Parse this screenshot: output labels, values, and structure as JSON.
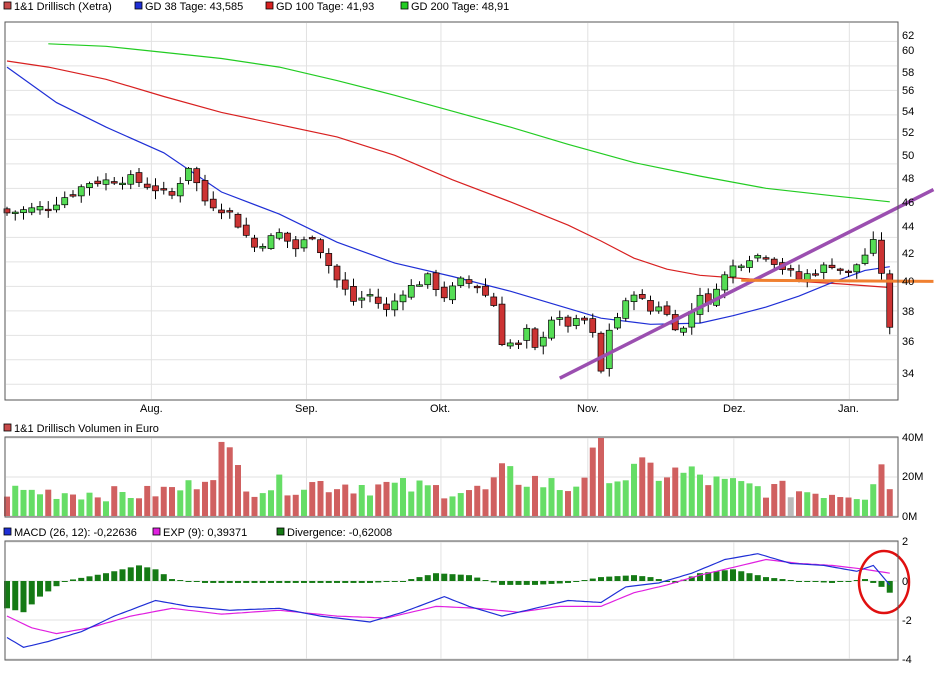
{
  "price_panel": {
    "legend": [
      {
        "label": "1&1 Drillisch (Xetra)",
        "color": "#c84a4a"
      },
      {
        "label": "GD 38 Tage: 43,585",
        "color": "#1f2fd6"
      },
      {
        "label": "GD 100 Tage: 41,93",
        "color": "#d82020"
      },
      {
        "label": "GD 200 Tage: 48,91",
        "color": "#22cc22"
      }
    ],
    "y_ticks": [
      "62",
      "60",
      "58",
      "56",
      "54",
      "52",
      "50",
      "48",
      "46",
      "44",
      "42",
      "40",
      "38",
      "36",
      "34"
    ],
    "x_ticks": [
      "Aug.",
      "Sep.",
      "Okt.",
      "Nov.",
      "Dez.",
      "Jan."
    ],
    "colors": {
      "up": "#55dd55",
      "down": "#cc3333",
      "trend": "#9b4fb0",
      "support": "#f08030"
    }
  },
  "volume_panel": {
    "title": "1&1 Drillisch Volumen in Euro",
    "y_ticks": [
      "40M",
      "20M",
      "0M"
    ]
  },
  "macd_panel": {
    "legend": [
      {
        "label": "MACD (26, 12): -0,22636",
        "color": "#1f2fd6"
      },
      {
        "label": "EXP (9): 0,39371",
        "color": "#e020e0"
      },
      {
        "label": "Divergence: -0,62008",
        "color": "#157a15"
      }
    ],
    "y_ticks": [
      "2",
      "0",
      "-2",
      "-4"
    ]
  },
  "chart_data": [
    {
      "type": "candlestick",
      "title": "1&1 Drillisch (Xetra)",
      "ylim": [
        32.8,
        63.5
      ],
      "x_ticks": [
        "Aug.",
        "Sep.",
        "Okt.",
        "Nov.",
        "Dez.",
        "Jan."
      ],
      "close_path": [
        [
          0,
          48.0
        ],
        [
          5,
          48.5
        ],
        [
          10,
          50.5
        ],
        [
          15,
          50.8
        ],
        [
          20,
          49.4
        ],
        [
          22,
          51.8
        ],
        [
          24,
          49.0
        ],
        [
          27,
          48.0
        ],
        [
          30,
          45.2
        ],
        [
          33,
          46.3
        ],
        [
          35,
          45.1
        ],
        [
          37,
          46.2
        ],
        [
          40,
          42.5
        ],
        [
          42,
          40.8
        ],
        [
          44,
          41.3
        ],
        [
          46,
          40.0
        ],
        [
          48,
          41.6
        ],
        [
          51,
          42.7
        ],
        [
          53,
          41.2
        ],
        [
          55,
          42.4
        ],
        [
          57,
          42.1
        ],
        [
          59,
          40.5
        ],
        [
          60,
          37.5
        ],
        [
          62,
          37.2
        ],
        [
          63,
          38.3
        ],
        [
          64,
          36.8
        ],
        [
          66,
          39.4
        ],
        [
          68,
          38.9
        ],
        [
          70,
          39.2
        ],
        [
          71,
          38.0
        ],
        [
          72,
          35.0
        ],
        [
          73,
          38.5
        ],
        [
          74,
          39.5
        ],
        [
          76,
          41.6
        ],
        [
          78,
          40.0
        ],
        [
          79,
          40.5
        ],
        [
          81,
          38.8
        ],
        [
          82,
          38.5
        ],
        [
          84,
          41.5
        ],
        [
          85,
          40.3
        ],
        [
          86,
          42.1
        ],
        [
          88,
          43.6
        ],
        [
          90,
          44.4
        ],
        [
          92,
          44.6
        ],
        [
          94,
          43.5
        ],
        [
          96,
          42.6
        ],
        [
          98,
          43.3
        ],
        [
          100,
          43.8
        ],
        [
          102,
          43.0
        ],
        [
          104,
          44.6
        ],
        [
          105,
          45.5
        ],
        [
          106,
          43.2
        ],
        [
          107,
          38.4
        ]
      ],
      "series": [
        {
          "name": "GD 38 Tage: 43,585",
          "color": "#1f2fd6",
          "path": [
            [
              0,
              59.9
            ],
            [
              6,
              57.0
            ],
            [
              12,
              55.0
            ],
            [
              19,
              52.9
            ],
            [
              26,
              49.7
            ],
            [
              33,
              47.9
            ],
            [
              40,
              45.6
            ],
            [
              47,
              43.9
            ],
            [
              54,
              42.8
            ],
            [
              61,
              41.6
            ],
            [
              67,
              40.4
            ],
            [
              72,
              39.4
            ],
            [
              78,
              38.9
            ],
            [
              84,
              39.0
            ],
            [
              88,
              39.6
            ],
            [
              92,
              40.3
            ],
            [
              96,
              41.2
            ],
            [
              100,
              42.3
            ],
            [
              104,
              43.3
            ],
            [
              107,
              43.6
            ]
          ]
        },
        {
          "name": "GD 100 Tage: 41,93",
          "color": "#d82020",
          "path": [
            [
              0,
              60.4
            ],
            [
              5,
              59.9
            ],
            [
              12,
              58.9
            ],
            [
              19,
              57.5
            ],
            [
              26,
              56.2
            ],
            [
              33,
              55.2
            ],
            [
              40,
              54.2
            ],
            [
              47,
              52.7
            ],
            [
              54,
              50.7
            ],
            [
              61,
              48.9
            ],
            [
              68,
              47.0
            ],
            [
              72,
              45.7
            ],
            [
              76,
              44.3
            ],
            [
              80,
              43.4
            ],
            [
              84,
              42.9
            ],
            [
              90,
              42.6
            ],
            [
              96,
              42.4
            ],
            [
              101,
              42.2
            ],
            [
              107,
              41.9
            ]
          ]
        },
        {
          "name": "GD 200 Tage: 48,91",
          "color": "#22cc22",
          "path": [
            [
              5,
              61.8
            ],
            [
              12,
              61.6
            ],
            [
              19,
              61.1
            ],
            [
              26,
              60.6
            ],
            [
              33,
              59.9
            ],
            [
              40,
              58.8
            ],
            [
              47,
              57.6
            ],
            [
              54,
              56.3
            ],
            [
              61,
              55.0
            ],
            [
              68,
              53.6
            ],
            [
              76,
              52.1
            ],
            [
              84,
              51.0
            ],
            [
              92,
              50.0
            ],
            [
              100,
              49.4
            ],
            [
              107,
              48.9
            ]
          ]
        }
      ],
      "trendlines": [
        {
          "name": "Aufwärtstrend",
          "from": [
            67,
            34.5
          ],
          "to": [
            112.3,
            49.9
          ]
        },
        {
          "name": "Unterstützung",
          "from": [
            89,
            42.5
          ],
          "to": [
            112.3,
            42.4
          ]
        }
      ]
    },
    {
      "type": "bar",
      "title": "1&1 Drillisch Volumen in Euro",
      "ylim": [
        0,
        40
      ],
      "unit": "M EUR",
      "volume_profile": [
        [
          0,
          14
        ],
        [
          8,
          13
        ],
        [
          16,
          12
        ],
        [
          22,
          16
        ],
        [
          26,
          35
        ],
        [
          30,
          16
        ],
        [
          36,
          18
        ],
        [
          40,
          18
        ],
        [
          48,
          16
        ],
        [
          52,
          15
        ],
        [
          58,
          14
        ],
        [
          60,
          22
        ],
        [
          63,
          21
        ],
        [
          68,
          15
        ],
        [
          72,
          34
        ],
        [
          74,
          22
        ],
        [
          78,
          25
        ],
        [
          84,
          22
        ],
        [
          86,
          18
        ],
        [
          92,
          15
        ],
        [
          100,
          13
        ],
        [
          104,
          12
        ],
        [
          106,
          34
        ],
        [
          107,
          15
        ]
      ]
    },
    {
      "type": "line",
      "title": "MACD",
      "ylim": [
        -4,
        2
      ],
      "series": [
        {
          "name": "MACD (26, 12): -0,22636",
          "color": "#1f2fd6",
          "path": [
            [
              0,
              -2.9
            ],
            [
              2,
              -3.4
            ],
            [
              5,
              -3.1
            ],
            [
              9,
              -2.6
            ],
            [
              13,
              -1.8
            ],
            [
              18,
              -1.0
            ],
            [
              22,
              -1.3
            ],
            [
              27,
              -1.5
            ],
            [
              33,
              -1.4
            ],
            [
              38,
              -1.8
            ],
            [
              44,
              -2.1
            ],
            [
              48,
              -1.6
            ],
            [
              53,
              -0.8
            ],
            [
              56,
              -1.3
            ],
            [
              60,
              -1.8
            ],
            [
              64,
              -1.4
            ],
            [
              68,
              -1.0
            ],
            [
              72,
              -1.1
            ],
            [
              75,
              -0.3
            ],
            [
              79,
              -0.1
            ],
            [
              83,
              0.4
            ],
            [
              87,
              1.1
            ],
            [
              91,
              1.4
            ],
            [
              95,
              0.9
            ],
            [
              99,
              0.8
            ],
            [
              103,
              0.5
            ],
            [
              105,
              0.8
            ],
            [
              107,
              -0.2
            ]
          ]
        },
        {
          "name": "EXP (9): 0,39371",
          "color": "#e020e0",
          "path": [
            [
              0,
              -1.8
            ],
            [
              3,
              -2.4
            ],
            [
              6,
              -2.7
            ],
            [
              10,
              -2.4
            ],
            [
              15,
              -1.8
            ],
            [
              20,
              -1.4
            ],
            [
              26,
              -1.7
            ],
            [
              33,
              -1.5
            ],
            [
              40,
              -1.8
            ],
            [
              46,
              -1.9
            ],
            [
              52,
              -1.3
            ],
            [
              57,
              -1.4
            ],
            [
              62,
              -1.6
            ],
            [
              67,
              -1.3
            ],
            [
              72,
              -1.3
            ],
            [
              76,
              -0.6
            ],
            [
              80,
              -0.2
            ],
            [
              84,
              0.3
            ],
            [
              88,
              0.7
            ],
            [
              92,
              1.1
            ],
            [
              96,
              0.9
            ],
            [
              100,
              0.8
            ],
            [
              104,
              0.6
            ],
            [
              107,
              0.4
            ]
          ]
        }
      ],
      "divergence_profile": [
        [
          0,
          -1.4
        ],
        [
          2,
          -1.6
        ],
        [
          4,
          -0.8
        ],
        [
          7,
          0.0
        ],
        [
          12,
          0.4
        ],
        [
          16,
          0.8
        ],
        [
          18,
          0.6
        ],
        [
          20,
          0.1
        ],
        [
          24,
          -0.1
        ],
        [
          36,
          -0.1
        ],
        [
          44,
          -0.1
        ],
        [
          48,
          0.0
        ],
        [
          52,
          0.4
        ],
        [
          56,
          0.3
        ],
        [
          60,
          -0.2
        ],
        [
          64,
          -0.2
        ],
        [
          68,
          -0.1
        ],
        [
          72,
          0.2
        ],
        [
          76,
          0.3
        ],
        [
          78,
          0.2
        ],
        [
          81,
          -0.1
        ],
        [
          84,
          0.4
        ],
        [
          88,
          0.6
        ],
        [
          92,
          0.2
        ],
        [
          96,
          0.0
        ],
        [
          100,
          -0.1
        ],
        [
          104,
          0.1
        ],
        [
          106,
          -0.3
        ],
        [
          107,
          -0.6
        ]
      ]
    }
  ]
}
